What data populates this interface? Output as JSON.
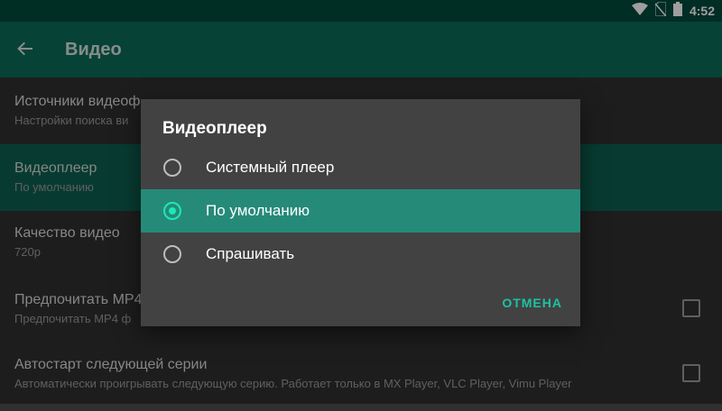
{
  "status_bar": {
    "time": "4:52",
    "icons": [
      "wifi-icon",
      "no-sim-icon",
      "battery-icon"
    ]
  },
  "app_bar": {
    "back_icon": "arrow-back-icon",
    "title": "Видео"
  },
  "settings": [
    {
      "title": "Источники видеоф",
      "subtitle": "Настройки поиска ви"
    },
    {
      "title": "Видеоплеер",
      "subtitle": "По умолчанию"
    },
    {
      "title": "Качество видео",
      "subtitle": "720p"
    },
    {
      "title": "Предпочитать MP4",
      "subtitle": "Предпочитать MP4 ф",
      "checked": false
    },
    {
      "title": "Автостарт следующей серии",
      "subtitle": "Автоматически проигрывать следующую серию. Работает только в MX Player, VLC Player, Vimu Player",
      "checked": false
    }
  ],
  "dialog": {
    "title": "Видеоплеер",
    "options": [
      {
        "label": "Системный плеер",
        "selected": false
      },
      {
        "label": "По умолчанию",
        "selected": true
      },
      {
        "label": "Спрашивать",
        "selected": false
      }
    ],
    "cancel_label": "ОТМЕНА"
  },
  "colors": {
    "status_bar": "#00493b",
    "app_bar": "#0c6b59",
    "accent": "#1de9b6",
    "dialog_bg": "#424242"
  }
}
